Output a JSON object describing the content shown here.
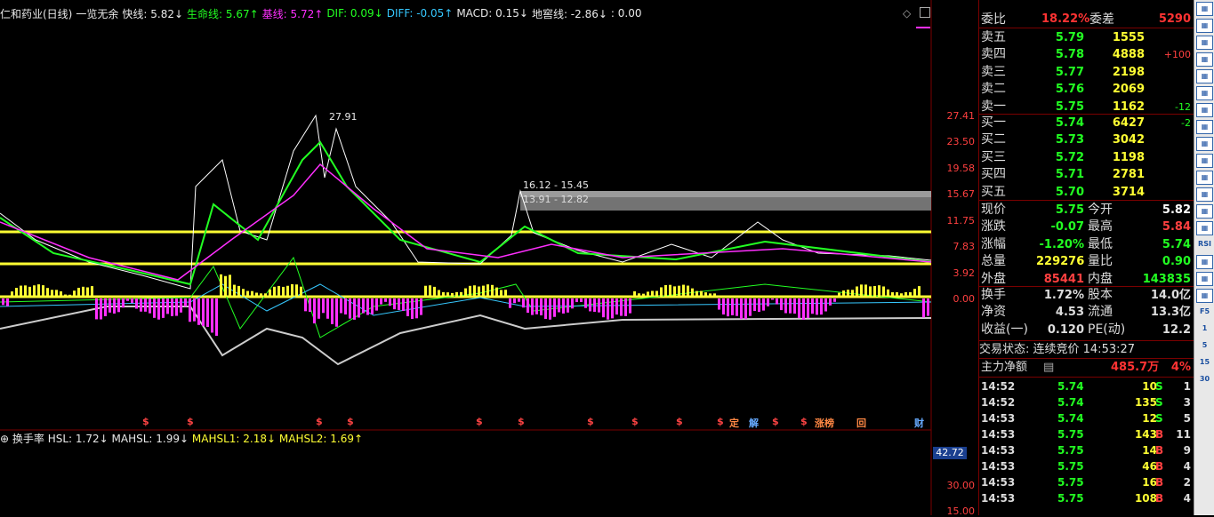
{
  "legend": {
    "stock": "仁和药业(日线)",
    "indicator": "一览无余",
    "fast": "快线: 5.82↓",
    "life": "生命线: 5.67↑",
    "base": "基线: 5.72↑",
    "dif": "DIF: 0.09↓",
    "diff": "DIFF: -0.05↑",
    "macd": "MACD: 0.15↓",
    "dijiao": "地窖线: -2.86↓",
    "zero": ": 0.00"
  },
  "price_axis": [
    "27.41",
    "23.50",
    "19.58",
    "15.67",
    "11.75",
    "7.83",
    "3.92",
    "0.00"
  ],
  "annotations": {
    "high": "27.91",
    "range1": "16.12 - 15.45",
    "range2": "13.91 - 12.82"
  },
  "event_markers": [
    "定",
    "解",
    "涨榜",
    "回",
    "财"
  ],
  "turnover": {
    "title": "换手率",
    "hsl": "HSL: 1.72↓",
    "mahsl": "MAHSL: 1.99↓",
    "mahsl1": "MAHSL1: 2.18↓",
    "mahsl2": "MAHSL2: 1.69↑",
    "axis_top": "42.72",
    "axis_mid": "30.00",
    "axis_low": "15.00"
  },
  "quote": {
    "weibi_label": "委比",
    "weibi": "18.22%",
    "weicha_label": "委差",
    "weicha": "5290",
    "asks": [
      {
        "label": "卖五",
        "price": "5.79",
        "vol": "1555",
        "chg": ""
      },
      {
        "label": "卖四",
        "price": "5.78",
        "vol": "4888",
        "chg": "+100"
      },
      {
        "label": "卖三",
        "price": "5.77",
        "vol": "2198",
        "chg": ""
      },
      {
        "label": "卖二",
        "price": "5.76",
        "vol": "2069",
        "chg": ""
      },
      {
        "label": "卖一",
        "price": "5.75",
        "vol": "1162",
        "chg": "-12"
      }
    ],
    "bids": [
      {
        "label": "买一",
        "price": "5.74",
        "vol": "6427",
        "chg": "-2"
      },
      {
        "label": "买二",
        "price": "5.73",
        "vol": "3042",
        "chg": ""
      },
      {
        "label": "买三",
        "price": "5.72",
        "vol": "1198",
        "chg": ""
      },
      {
        "label": "买四",
        "price": "5.71",
        "vol": "2781",
        "chg": ""
      },
      {
        "label": "买五",
        "price": "5.70",
        "vol": "3714",
        "chg": ""
      }
    ],
    "stats": [
      {
        "l1": "现价",
        "v1": "5.75",
        "l2": "今开",
        "v2": "5.82"
      },
      {
        "l1": "涨跌",
        "v1": "-0.07",
        "l2": "最高",
        "v2": "5.84"
      },
      {
        "l1": "涨幅",
        "v1": "-1.20%",
        "l2": "最低",
        "v2": "5.74"
      },
      {
        "l1": "总量",
        "v1": "229276",
        "l2": "量比",
        "v2": "0.90"
      },
      {
        "l1": "外盘",
        "v1": "85441",
        "l2": "内盘",
        "v2": "143835"
      }
    ],
    "stats2": [
      {
        "l1": "换手",
        "v1": "1.72%",
        "l2": "股本",
        "v2": "14.0亿"
      },
      {
        "l1": "净资",
        "v1": "4.53",
        "l2": "流通",
        "v2": "13.3亿"
      },
      {
        "l1": "收益(一)",
        "v1": "0.120",
        "l2": "PE(动)",
        "v2": "12.2"
      }
    ],
    "trade_status": "交易状态: 连续竞价 14:53:27",
    "main_flow_label": "主力净额",
    "main_flow": "485.7万",
    "main_flow_pct": "4%"
  },
  "ticks": [
    {
      "t": "14:52",
      "p": "5.74",
      "v": "10",
      "s": "S",
      "n": "1"
    },
    {
      "t": "14:52",
      "p": "5.74",
      "v": "135",
      "s": "S",
      "n": "3"
    },
    {
      "t": "14:53",
      "p": "5.74",
      "v": "12",
      "s": "S",
      "n": "5"
    },
    {
      "t": "14:53",
      "p": "5.75",
      "v": "143",
      "s": "B",
      "n": "11"
    },
    {
      "t": "14:53",
      "p": "5.75",
      "v": "14",
      "s": "B",
      "n": "9"
    },
    {
      "t": "14:53",
      "p": "5.75",
      "v": "46",
      "s": "B",
      "n": "4"
    },
    {
      "t": "14:53",
      "p": "5.75",
      "v": "16",
      "s": "B",
      "n": "2"
    },
    {
      "t": "14:53",
      "p": "5.75",
      "v": "108",
      "s": "B",
      "n": "4"
    }
  ],
  "toolbar": [
    "RSI"
  ]
}
